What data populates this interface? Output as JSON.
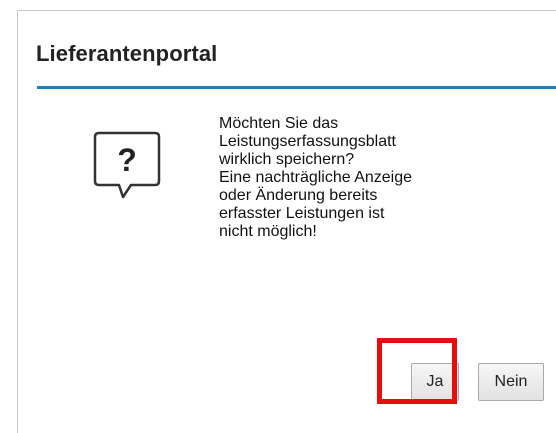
{
  "dialog": {
    "title": "Lieferantenportal",
    "icon": "question-speech-bubble-icon",
    "accent_color": "#1f7ec0",
    "message_lines": [
      "Möchten Sie das",
      "Leistungserfassungsblatt",
      "wirklich speichern?",
      "Eine nachträgliche Anzeige",
      "oder Änderung bereits",
      "erfasster Leistungen ist",
      "nicht möglich!"
    ],
    "buttons": {
      "yes_label": "Ja",
      "no_label": "Nein"
    },
    "highlight_color": "#e50e0e"
  }
}
